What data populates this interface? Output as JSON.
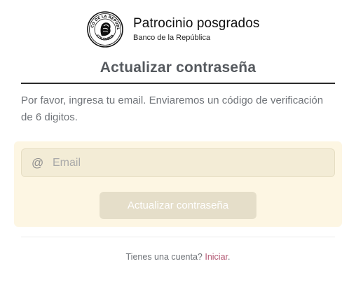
{
  "brand": {
    "title": "Patrocinio posgrados",
    "subtitle": "Banco de la República",
    "seal_text_top": "BANCO DE LA REPUBLICA",
    "seal_text_bottom": "COLOMBIA",
    "logo_icon": "banco-republica-seal"
  },
  "page": {
    "title": "Actualizar contraseña",
    "intro": "Por favor, ingresa tu email. Enviaremos un código de verificación de 6 digitos."
  },
  "form": {
    "email_icon": "at-sign-icon",
    "email_glyph": "@",
    "email_placeholder": "Email",
    "email_value": "",
    "submit_label": "Actualizar contraseña"
  },
  "footer": {
    "prompt": "Tienes una cuenta?",
    "link_label": "Iniciar",
    "suffix": "."
  },
  "colors": {
    "panel_bg": "#fdf6e3",
    "field_bg": "#f3ecd6",
    "button_bg": "#e5dec9",
    "link": "#b45a75",
    "title": "#55595e"
  }
}
